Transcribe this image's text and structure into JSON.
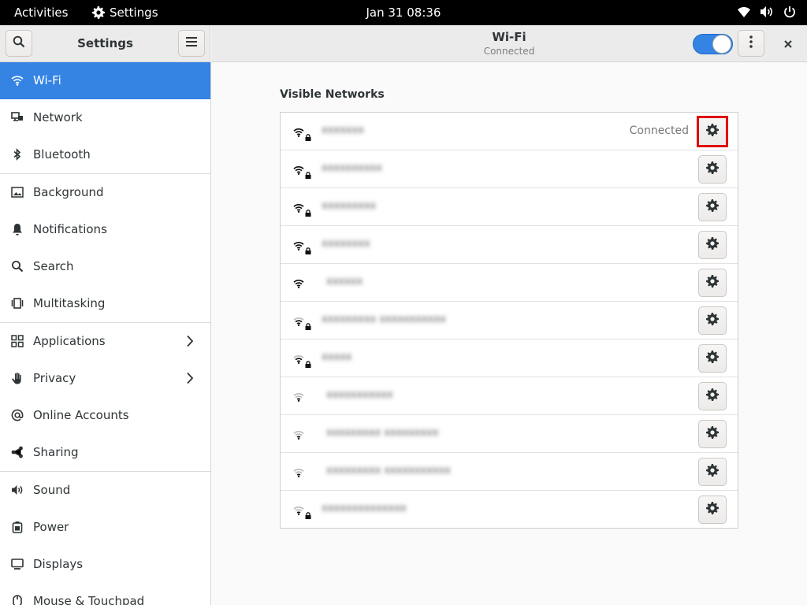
{
  "topbar": {
    "activities": "Activities",
    "app_name": "Settings",
    "clock": "Jan 31  08:36"
  },
  "sidebar": {
    "title": "Settings",
    "items": [
      {
        "label": "Wi-Fi",
        "icon": "wifi-icon",
        "active": true
      },
      {
        "label": "Network",
        "icon": "network-icon"
      },
      {
        "label": "Bluetooth",
        "icon": "bluetooth-icon"
      },
      {
        "label": "Background",
        "icon": "background-icon"
      },
      {
        "label": "Notifications",
        "icon": "bell-icon"
      },
      {
        "label": "Search",
        "icon": "search-icon"
      },
      {
        "label": "Multitasking",
        "icon": "multitasking-icon"
      },
      {
        "label": "Applications",
        "icon": "applications-icon",
        "chevron": true
      },
      {
        "label": "Privacy",
        "icon": "hand-icon",
        "chevron": true
      },
      {
        "label": "Online Accounts",
        "icon": "at-icon"
      },
      {
        "label": "Sharing",
        "icon": "share-icon"
      },
      {
        "label": "Sound",
        "icon": "speaker-icon"
      },
      {
        "label": "Power",
        "icon": "power-icon"
      },
      {
        "label": "Displays",
        "icon": "display-icon"
      },
      {
        "label": "Mouse & Touchpad",
        "icon": "mouse-icon"
      }
    ]
  },
  "header": {
    "title": "Wi-Fi",
    "subtitle": "Connected",
    "wifi_enabled": true
  },
  "content": {
    "section_title": "Visible Networks",
    "networks": [
      {
        "ssid": "xxxxxxx",
        "secured": true,
        "strength": "strong",
        "status": "Connected",
        "highlighted": true
      },
      {
        "ssid": "xxxxxxxxxx",
        "secured": true,
        "strength": "strong",
        "status": ""
      },
      {
        "ssid": "xxxxxxxxx",
        "secured": true,
        "strength": "strong",
        "status": ""
      },
      {
        "ssid": "xxxxxxxx",
        "secured": true,
        "strength": "strong",
        "status": ""
      },
      {
        "ssid": "xxxxxx",
        "secured": false,
        "strength": "strong",
        "status": ""
      },
      {
        "ssid": "xxxxxxxxx xxxxxxxxxxx",
        "secured": true,
        "strength": "medium",
        "status": ""
      },
      {
        "ssid": "xxxxx",
        "secured": true,
        "strength": "medium",
        "status": ""
      },
      {
        "ssid": "xxxxxxxxxxx",
        "secured": false,
        "strength": "weak",
        "status": ""
      },
      {
        "ssid": "xxxxxxxxx xxxxxxxxx",
        "secured": false,
        "strength": "weak",
        "status": ""
      },
      {
        "ssid": "xxxxxxxxx xxxxxxxxxxx",
        "secured": false,
        "strength": "weak",
        "status": ""
      },
      {
        "ssid": "xxxxxxxxxxxxxx",
        "secured": true,
        "strength": "weak",
        "status": ""
      }
    ]
  },
  "colors": {
    "accent": "#3584e4",
    "highlight_border": "#e00000"
  }
}
